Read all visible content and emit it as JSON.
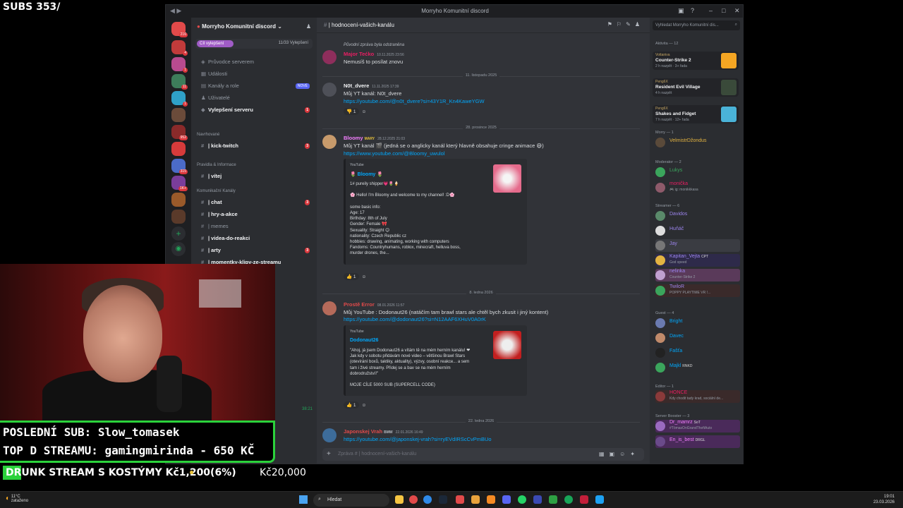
{
  "stream": {
    "subs_counter": "SUBS 353/",
    "last_sub": "POSLEDNÍ SUB: Slow_tomasek",
    "top_donor": "TOP D STREAMU: gamingmirinda - 650 KČ",
    "goal_text": "DRUNK STREAM S KOSTÝMY Kč1,200(6%)",
    "goal_target": "Kč20,000"
  },
  "window": {
    "title": "Morryho Komunitní discord"
  },
  "rail": {
    "badges": [
      "216",
      "4",
      "1",
      "11",
      "1",
      "952",
      "1K+",
      "315"
    ]
  },
  "sidebar": {
    "server_name": "Morryho Komunitní discord",
    "boost_goal": "Cíl vylepšení",
    "boost_count": "11/33 Vylepšení",
    "items": [
      {
        "label": "Průvodce serverem",
        "icon": "◈"
      },
      {
        "label": "Události",
        "icon": "▦"
      },
      {
        "label": "Kanály a role",
        "icon": "▤",
        "tag": "NOVÉ"
      },
      {
        "label": "Uživatelé",
        "icon": "♟"
      },
      {
        "label": "Vylepšení serveru",
        "icon": "◆",
        "count": "1"
      }
    ],
    "categories": [
      "Navrhované",
      "Pravidla & Informace",
      "Komunikační Kanály"
    ],
    "channels": [
      {
        "label": "| kick-twitch",
        "count": "3"
      },
      {
        "label": "| vítej"
      },
      {
        "label": "| chat",
        "count": "3"
      },
      {
        "label": "| hry-a-akce"
      },
      {
        "label": "| memes"
      },
      {
        "label": "| videa-do-reakci"
      },
      {
        "label": "| arty",
        "count": "3"
      },
      {
        "label": "| momentky-klipy-ze-streamu"
      }
    ],
    "user_status": "38:21"
  },
  "channel": {
    "name": "| hodnocení-vašich-kanálu",
    "composer_placeholder": "Zpráva # | hodnocení-vašich-kanálu"
  },
  "messages": [
    {
      "author": "Major Tećko",
      "time": "10.11.2025 23:56",
      "reply": "Původní zpráva byla odstraněna",
      "text": "Nemusíš to posílat znovu"
    },
    {
      "divider": "11. listopadu 2025"
    },
    {
      "author": "N0t_dvere",
      "time": "11.11.2025 17:39",
      "text": "Můj YT kanál: N0t_dvere",
      "link": "https://youtube.com/@n0t_dvere?si=43Y1R_Kn4KaweYGW",
      "reaction": "1"
    },
    {
      "divider": "28. prosince 2025"
    },
    {
      "author": "Bloomy",
      "tag": "MARY",
      "time": "28.12.2025 21:03",
      "text": "Můj YT kanál 🎬 (jedná se o anglicky kanál který hlavně obsahuje cringe animace 😅)",
      "link": "https://www.youtube.com/@Bloomy_uwulol",
      "embed": {
        "provider": "YouTube",
        "title": "🌷 Bloomy 🌷",
        "body": "1# pureily shipper💗🌷🍦\n\n🌸 Hello! I'm Bloomy and welcome to my channel! :D🌸\n\nsome basic info:\nAge: 17\nBirthday: 8th of July\nGender: Female 🎀\nSexuality: Straight 😊\nnationality: Czech Republic cz\nhobbies: drawing, animating, working with computers\nFandoms: Countryhumans, roblox, minecraft, helluva boss,\nmurder drones, the..."
      },
      "reaction": "1"
    },
    {
      "divider": "8. ledna 2026"
    },
    {
      "author": "Prostě Error",
      "time": "08.01.2026 11:57",
      "text": "Můj YouTube : Dodonaut26 (natáčím tam brawl stars ale chtěl bych zkusit i jiný kontent)",
      "link": "https://youtube.com/@dodonaut26?si=N12AAF6XHuV0A0rK",
      "embed": {
        "provider": "YouTube",
        "title": "Dodonaut26",
        "body": "\"Ahoj, já jsem Dodonaut26 a vítám tě na mém herním kanálu! ❤\nJak kdy v sobotu přidávám nové video – většinou Brawl Stars\n(otevírání boxů, taktiky, aktuality), výzvy, osobní reakce... a sem\ntam i živé streamy. Přidej se a bav se na mém herním\ndobrodružství!\"\n\nMOJE CÍLE 5000 SUB (SUPERCELL CODE)"
      },
      "reaction": "1"
    },
    {
      "divider": "22. ledna 2026"
    },
    {
      "author": "Japonskej Vrah",
      "tag": "BMW",
      "time": "22.01.2026 16:49",
      "link": "https://youtube.com/@japonskej-vrah?si=ryEVdIRScCvPmBUo"
    }
  ],
  "members": {
    "search_placeholder": "Vyhledat Morryho Komunitní dis...",
    "activity_header": "Aktivita — 12",
    "activities": [
      {
        "user": "Vottaniva",
        "game": "Counter-Strike 2",
        "time": "2 h nazpět · 3+ řada"
      },
      {
        "user": "Peng6X",
        "game": "Resident Evil Village",
        "time": "4 h nazpět"
      },
      {
        "user": "Peng6X",
        "game": "Shakes and Fidget",
        "time": "7 h nazpět · 12+ řada"
      }
    ],
    "groups": [
      {
        "header": "Morry — 1",
        "members": [
          {
            "name": "VelmistrDžondus",
            "color": "#e3b341"
          }
        ]
      },
      {
        "header": "Moderator — 2",
        "members": [
          {
            "name": "Lukys",
            "color": "#3ba55c"
          },
          {
            "name": "monička",
            "color": "#e91e63",
            "status": "🎮 ig: monikkkasa"
          }
        ]
      },
      {
        "header": "Streamer — 6",
        "members": [
          {
            "name": "Davidos",
            "color": "#9b84ec"
          },
          {
            "name": "Huňáč",
            "color": "#9b84ec"
          },
          {
            "name": "Jay",
            "color": "#9b84ec"
          },
          {
            "name": "Kapitan_Vejta",
            "color": "#9b84ec",
            "tag": "CPT",
            "status": "God speed"
          },
          {
            "name": "nelinka",
            "color": "#9b84ec",
            "status": "Counter-Strike 2"
          },
          {
            "name": "TwiloR",
            "color": "#9b84ec",
            "status": "POPPY PLAYTIME VR !..."
          }
        ]
      },
      {
        "header": "Guest — 4",
        "members": [
          {
            "name": "Bright",
            "color": "#00a8fc"
          },
          {
            "name": "Davec",
            "color": "#00a8fc"
          },
          {
            "name": "Fašťa",
            "color": "#00a8fc"
          },
          {
            "name": "Majkl",
            "color": "#00a8fc",
            "tag": "RNKD"
          }
        ]
      },
      {
        "header": "Editor — 1",
        "members": [
          {
            "name": "HONCE",
            "color": "#e91e63",
            "status": "Kdy chodit tady krad, sociální de..."
          }
        ]
      },
      {
        "header": "Server Booster — 3",
        "members": [
          {
            "name": "Dr_mamrz",
            "color": "#f47fff",
            "tag": "SoT",
            "status": "#TömasOnGrandTheftAuto"
          },
          {
            "name": "En_is_best",
            "color": "#f47fff",
            "tag": "DRGL"
          }
        ]
      }
    ]
  },
  "taskbar": {
    "weather": "11°C\nzataženo",
    "search": "Hledat",
    "time": "19:01",
    "date": "23.03.2026"
  }
}
